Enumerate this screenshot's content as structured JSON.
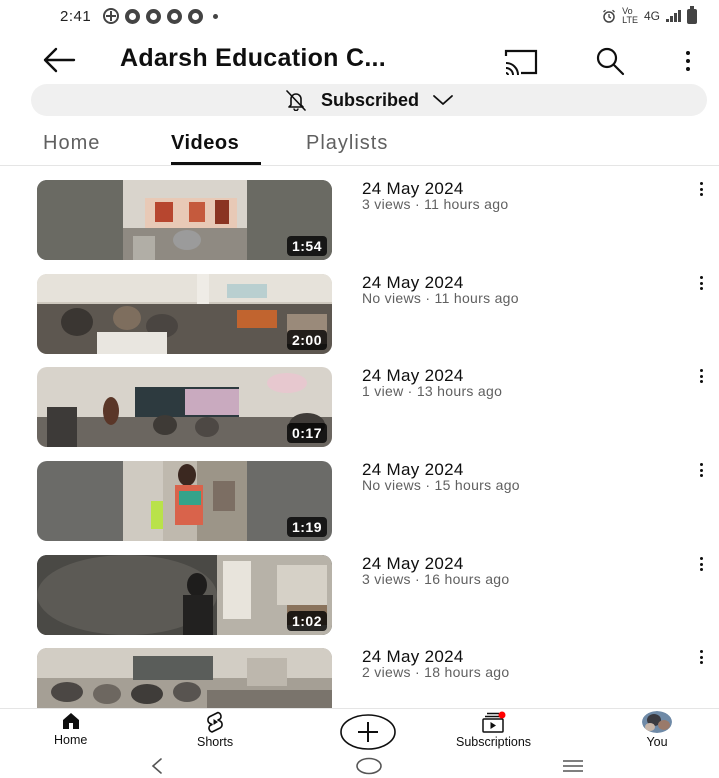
{
  "status_bar": {
    "time": "2:41",
    "network": "4G",
    "alarm_icon": "alarm-icon",
    "signal_icon": "signal-icon",
    "battery_icon": "battery-icon"
  },
  "app_bar": {
    "title": "Adarsh Education C...",
    "back_icon": "arrow-left-icon",
    "cast_icon": "cast-icon",
    "search_icon": "search-icon",
    "more_icon": "more-vertical-icon"
  },
  "subscribe": {
    "label": "Subscribed",
    "bell_icon": "bell-off-icon",
    "chevron_icon": "chevron-down-icon"
  },
  "tabs": [
    {
      "label": "Home",
      "active": false
    },
    {
      "label": "Videos",
      "active": true
    },
    {
      "label": "Playlists",
      "active": false
    }
  ],
  "videos": [
    {
      "title": "24 May 2024",
      "meta": "3 views · 11 hours ago",
      "duration": "1:54"
    },
    {
      "title": "24 May 2024",
      "meta": "No views · 11 hours ago",
      "duration": "2:00"
    },
    {
      "title": "24 May 2024",
      "meta": "1 view · 13 hours ago",
      "duration": "0:17"
    },
    {
      "title": "24 May 2024",
      "meta": "No views · 15 hours ago",
      "duration": "1:19"
    },
    {
      "title": "24 May 2024",
      "meta": "3 views · 16 hours ago",
      "duration": "1:02"
    },
    {
      "title": "24 May 2024",
      "meta": "2 views · 18 hours ago",
      "duration": ""
    }
  ],
  "bottom_nav": [
    {
      "label": "Home",
      "icon": "home-icon"
    },
    {
      "label": "Shorts",
      "icon": "shorts-icon"
    },
    {
      "label": "",
      "icon": "create-icon"
    },
    {
      "label": "Subscriptions",
      "icon": "subscriptions-icon"
    },
    {
      "label": "You",
      "icon": "avatar"
    }
  ],
  "colors": {
    "text_primary": "#0f0f0f",
    "text_secondary": "#606060",
    "pill_bg": "#f0f0f0",
    "notification_red": "#ff0000"
  }
}
